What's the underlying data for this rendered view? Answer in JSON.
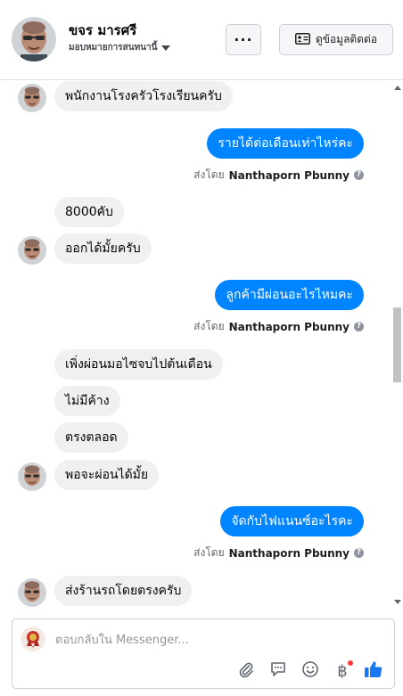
{
  "header": {
    "contact_name": "ขจร มารศรี",
    "assign_label": "มอบหมายการสนทนานี้",
    "more_label": "···",
    "contact_info_label": "ดูข้อมูลติดต่อ"
  },
  "messages": [
    {
      "dir": "in",
      "text": "พนักงานโรงครัวโรงเรียนครับ"
    },
    {
      "dir": "out",
      "text": "รายได้ต่อเดือนเท่าไหร่คะ"
    },
    {
      "dir": "in",
      "text": "8000คับ"
    },
    {
      "dir": "in",
      "text": "ออกได้มั้ยครับ"
    },
    {
      "dir": "out",
      "text": "ลูกค้ามีผ่อนอะไรไหมคะ"
    },
    {
      "dir": "in",
      "text": "เพิ่งผ่อนมอไซจบไปต้นเดือน"
    },
    {
      "dir": "in",
      "text": "ไม่มีค้าง"
    },
    {
      "dir": "in",
      "text": "ตรงตลอด"
    },
    {
      "dir": "in",
      "text": "พอจะผ่อนได้มั้ย"
    },
    {
      "dir": "out",
      "text": "จัดกับไฟแนนซ์อะไรคะ"
    },
    {
      "dir": "in",
      "text": "ส่งร้านรถโดยตรงครับ"
    }
  ],
  "sent_by": {
    "prefix": "ส่งโดย",
    "name": "Nanthaporn Pbunny",
    "help": "?"
  },
  "composer": {
    "placeholder": "ตอบกลับใน Messenger...",
    "currency_symbol": "฿"
  },
  "icons": {
    "attach": "paperclip-icon",
    "saved_replies": "chat-bubble-icon",
    "emoji": "smiley-icon",
    "payment": "baht-icon",
    "like": "thumbs-up-icon"
  },
  "colors": {
    "outgoing_bubble": "#0084ff",
    "incoming_bubble": "#f0f0f0",
    "like_icon": "#1877f2",
    "notification_dot": "#fa3e3e"
  }
}
